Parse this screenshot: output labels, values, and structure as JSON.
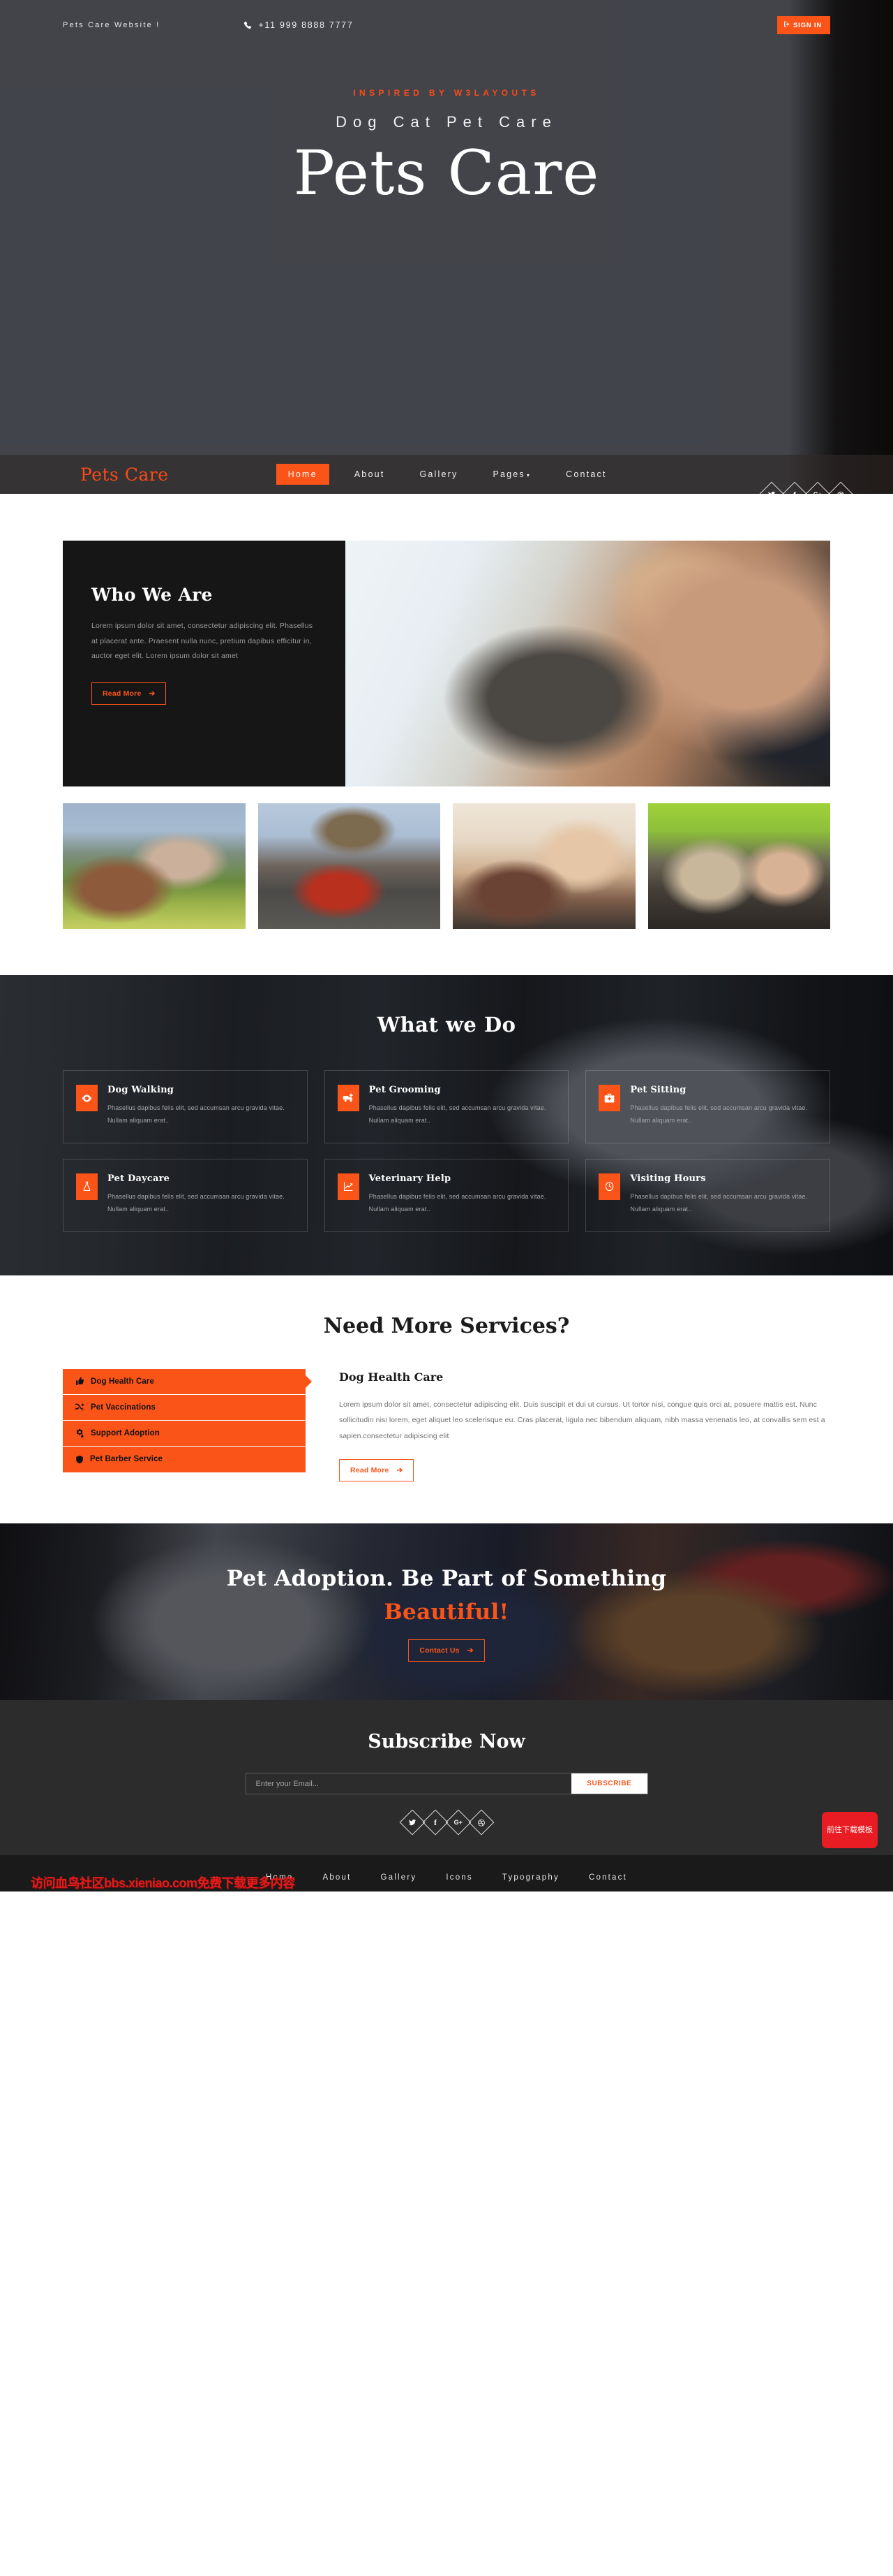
{
  "topbar": {
    "tagline": "Pets Care Website !",
    "phone": "+11 999 8888 7777",
    "phone_icon": "phone-icon",
    "signin_label": "SIGN IN",
    "signin_icon": "sign-in-icon"
  },
  "hero": {
    "kicker": "INSPIRED BY W3LAYOUTS",
    "subtitle": "Dog Cat Pet Care",
    "title": "Pets Care"
  },
  "nav": {
    "logo": "Pets Care",
    "items": [
      {
        "label": "Home",
        "active": true
      },
      {
        "label": "About",
        "active": false
      },
      {
        "label": "Gallery",
        "active": false
      },
      {
        "label": "Pages",
        "active": false,
        "caret": "▾"
      },
      {
        "label": "Contact",
        "active": false
      }
    ],
    "social": [
      {
        "name": "twitter-icon",
        "glyph": "🐦"
      },
      {
        "name": "facebook-icon",
        "glyph": "f"
      },
      {
        "name": "google-plus-icon",
        "glyph": "G+"
      },
      {
        "name": "dribbble-icon",
        "glyph": "⚽"
      }
    ]
  },
  "about": {
    "heading": "Who We Are",
    "body": "Lorem ipsum dolor sit amet, consectetur adipiscing elit. Phasellus at placerat ante. Praesent nulla nunc, pretium dapibus efficitur in, auctor eget elit. Lorem ipsum dolor sit amet",
    "button": "Read More",
    "button_arrow": "➔",
    "image_alt": "man-holding-kitten"
  },
  "gallery": {
    "items": [
      {
        "alt": "woman-with-puppy-on-grass"
      },
      {
        "alt": "man-in-cap-holding-husky"
      },
      {
        "alt": "blonde-woman-hugging-dog"
      },
      {
        "alt": "girl-cuddling-mastiff"
      }
    ]
  },
  "services": {
    "title": "What we Do",
    "cards": [
      {
        "icon": "eye-icon",
        "title": "Dog Walking",
        "text": "Phasellus dapibus felis elit, sed accumsan arcu gravida vitae. Nullam aliquam erat.."
      },
      {
        "icon": "ambulance-icon",
        "title": "Pet Grooming",
        "text": "Phasellus dapibus felis elit, sed accumsan arcu gravida vitae. Nullam aliquam erat.."
      },
      {
        "icon": "medkit-icon",
        "title": "Pet Sitting",
        "text": "Phasellus dapibus felis elit, sed accumsan arcu gravida vitae. Nullam aliquam erat.."
      },
      {
        "icon": "flask-icon",
        "title": "Pet Daycare",
        "text": "Phasellus dapibus felis elit, sed accumsan arcu gravida vitae. Nullam aliquam erat.."
      },
      {
        "icon": "chart-line-icon",
        "title": "Veterinary Help",
        "text": "Phasellus dapibus felis elit, sed accumsan arcu gravida vitae. Nullam aliquam erat.."
      },
      {
        "icon": "clock-icon",
        "title": "Visiting Hours",
        "text": "Phasellus dapibus felis elit, sed accumsan arcu gravida vitae. Nullam aliquam erat.."
      }
    ]
  },
  "more_services": {
    "title": "Need More Services?",
    "tabs": [
      {
        "label": "Dog Health Care",
        "icon": "thumbs-up-icon",
        "active": true
      },
      {
        "label": "Pet Vaccinations",
        "icon": "shuffle-icon",
        "active": false
      },
      {
        "label": "Support Adoption",
        "icon": "cogs-icon",
        "active": false
      },
      {
        "label": "Pet Barber Service",
        "icon": "shield-icon",
        "active": false
      }
    ],
    "pane": {
      "heading": "Dog Health Care",
      "body": "Lorem ipsum dolor sit amet, consectetur adipiscing elit. Duis suscipit et dui ut cursus. Ut tortor nisi, congue quis orci at, posuere mattis est. Nunc sollicitudin nisi lorem, eget aliquet leo scelerisque eu. Cras placerat, ligula nec bibendum aliquam, nibh massa venenatis leo, at convallis sem est a sapien.consectetur adipiscing elit",
      "button": "Read More",
      "button_arrow": "➔"
    }
  },
  "adoption": {
    "line1": "Pet Adoption. Be Part of Something",
    "line2": "Beautiful!",
    "button": "Contact Us",
    "button_arrow": "➔"
  },
  "subscribe": {
    "title": "Subscribe Now",
    "placeholder": "Enter your Email...",
    "value": "",
    "button": "SUBSCRIBE",
    "social": [
      {
        "name": "twitter-icon",
        "glyph": "🐦"
      },
      {
        "name": "facebook-icon",
        "glyph": "f"
      },
      {
        "name": "google-plus-icon",
        "glyph": "G+"
      },
      {
        "name": "dribbble-icon",
        "glyph": "⚽"
      }
    ]
  },
  "footer": {
    "nav": [
      "Home",
      "About",
      "Gallery",
      "Icons",
      "Typography",
      "Contact"
    ],
    "watermark": "访问血鸟社区bbs.xieniao.com免费下载更多内容",
    "download_button": "前往下载模板"
  },
  "colors": {
    "accent": "#fb5419",
    "dark": "#161616",
    "subscribe_bg": "#2c2c2c",
    "footer_bg": "#1a1a1a",
    "download_red": "#e81c22"
  }
}
